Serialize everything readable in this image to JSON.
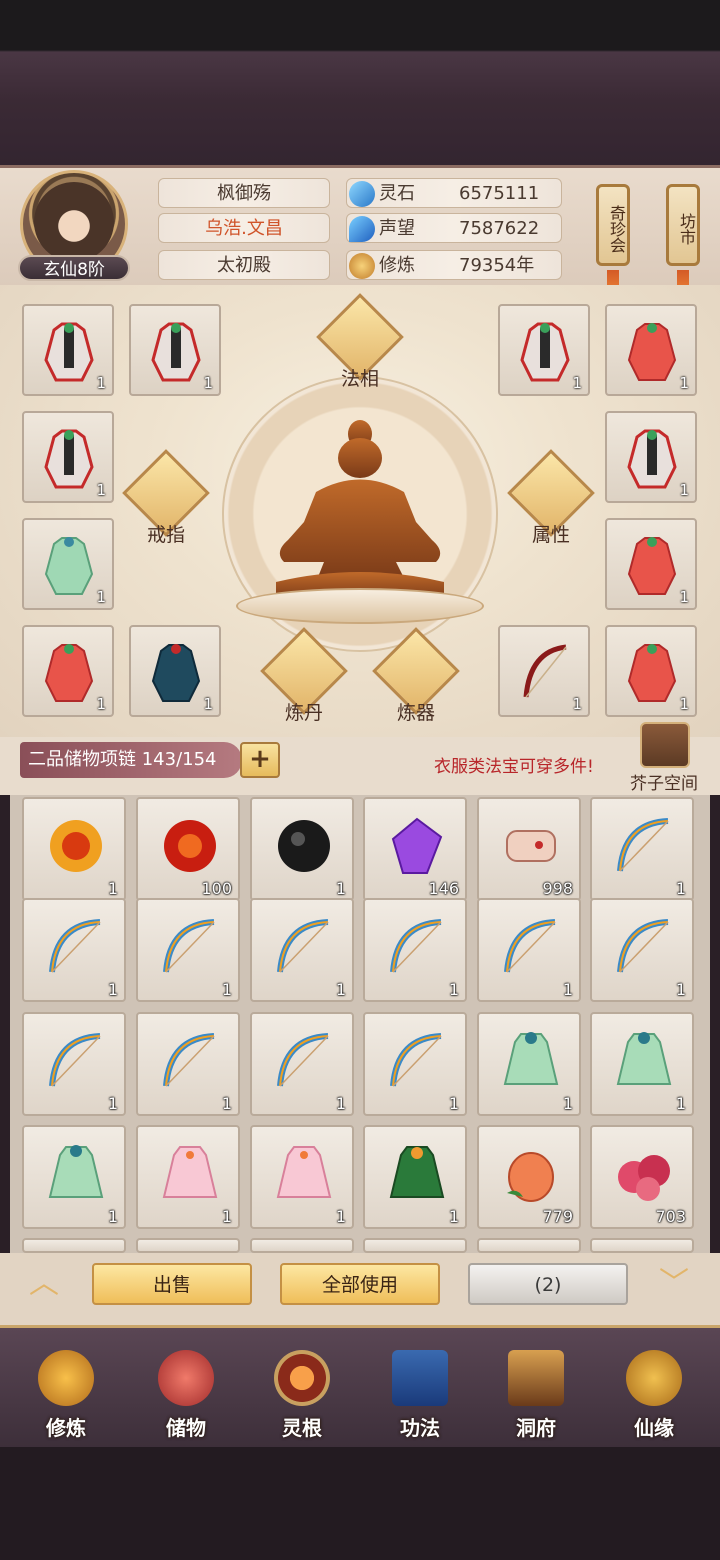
{
  "player": {
    "rank": "玄仙8阶",
    "name": "枫御殇",
    "title": "乌浩.文昌",
    "sect": "太初殿"
  },
  "resources": [
    {
      "label": "灵石",
      "value": "6575111",
      "icon": "spirit-stone-icon"
    },
    {
      "label": "声望",
      "value": "7587622",
      "icon": "prestige-icon"
    },
    {
      "label": "修炼",
      "value": "79354年",
      "icon": "cultivation-icon"
    }
  ],
  "side_buttons": {
    "treasure": "奇珍会",
    "market": "坊市"
  },
  "equipment": {
    "labels": {
      "dharma": "法相",
      "ring": "戒指",
      "attribute": "属性",
      "alchemy": "炼丹",
      "refine": "炼器"
    },
    "slots": [
      "1",
      "1",
      "1",
      "1",
      "1",
      "1",
      "1",
      "1",
      "1",
      "1",
      "1",
      "1",
      "1",
      "1"
    ]
  },
  "storage": {
    "tab": "二品储物项链 143/154",
    "add": "+",
    "notice": "衣服类法宝可穿多件!",
    "space": "芥子空间"
  },
  "inventory": [
    {
      "icon": "fire-orb-icon",
      "qty": "1"
    },
    {
      "icon": "red-orb-icon",
      "qty": "100"
    },
    {
      "icon": "black-orb-icon",
      "qty": "1"
    },
    {
      "icon": "purple-crystal-icon",
      "qty": "146"
    },
    {
      "icon": "scroll-icon",
      "qty": "998"
    },
    {
      "icon": "bow-icon",
      "qty": "1"
    },
    {
      "icon": "bow-icon",
      "qty": "1"
    },
    {
      "icon": "bow-icon",
      "qty": "1"
    },
    {
      "icon": "bow-icon",
      "qty": "1"
    },
    {
      "icon": "bow-icon",
      "qty": "1"
    },
    {
      "icon": "bow-icon",
      "qty": "1"
    },
    {
      "icon": "bow-icon",
      "qty": "1"
    },
    {
      "icon": "bow-icon",
      "qty": "1"
    },
    {
      "icon": "bow-icon",
      "qty": "1"
    },
    {
      "icon": "bow-icon",
      "qty": "1"
    },
    {
      "icon": "bow-icon",
      "qty": "1"
    },
    {
      "icon": "green-robe-icon",
      "qty": "1"
    },
    {
      "icon": "green-robe-icon",
      "qty": "1"
    },
    {
      "icon": "green-robe-icon",
      "qty": "1"
    },
    {
      "icon": "pink-robe-icon",
      "qty": "1"
    },
    {
      "icon": "pink-robe-icon",
      "qty": "1"
    },
    {
      "icon": "leaf-robe-icon",
      "qty": "1"
    },
    {
      "icon": "peach-icon",
      "qty": "779"
    },
    {
      "icon": "berries-icon",
      "qty": "703"
    }
  ],
  "actions": {
    "sell": "出售",
    "use_all": "全部使用",
    "count": "(2)"
  },
  "nav": [
    {
      "label": "修炼",
      "icon": "cultivate-icon"
    },
    {
      "label": "储物",
      "icon": "storage-bag-icon"
    },
    {
      "label": "灵根",
      "icon": "spirit-root-icon"
    },
    {
      "label": "功法",
      "icon": "technique-book-icon"
    },
    {
      "label": "洞府",
      "icon": "cave-house-icon"
    },
    {
      "label": "仙缘",
      "icon": "gourd-icon"
    }
  ]
}
